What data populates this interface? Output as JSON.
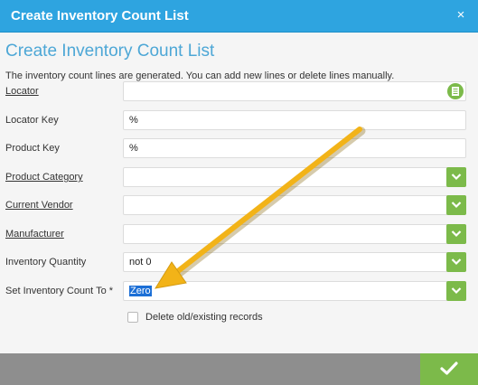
{
  "window": {
    "title": "Create Inventory Count List",
    "close_symbol": "×"
  },
  "form": {
    "heading": "Create Inventory Count List",
    "description": "The inventory count lines are generated. You can add new lines or delete lines manually.",
    "fields": [
      {
        "label": "Locator",
        "value": "",
        "underline": true,
        "control": "search"
      },
      {
        "label": "Locator Key",
        "value": "%",
        "underline": false,
        "control": "text"
      },
      {
        "label": "Product Key",
        "value": "%",
        "underline": false,
        "control": "text"
      },
      {
        "label": "Product Category",
        "value": "",
        "underline": true,
        "control": "dropdown"
      },
      {
        "label": "Current Vendor",
        "value": "",
        "underline": true,
        "control": "dropdown"
      },
      {
        "label": "Manufacturer",
        "value": "",
        "underline": true,
        "control": "dropdown"
      },
      {
        "label": "Inventory Quantity",
        "value": "not 0",
        "underline": false,
        "control": "dropdown"
      },
      {
        "label": "Set Inventory Count To *",
        "value": "Zero",
        "underline": false,
        "control": "dropdown",
        "selected_text": true
      }
    ],
    "checkbox": {
      "label": "Delete old/existing records",
      "checked": false
    }
  },
  "colors": {
    "title_bar": "#2ea4e0",
    "heading": "#4da7d6",
    "accent_green": "#7cba4a",
    "footer": "#8e8e8e",
    "arrow": "#f2b318"
  },
  "icons": {
    "close": "close-icon",
    "search": "search-list-icon",
    "dropdown": "chevron-down-icon",
    "ok": "checkmark-icon"
  }
}
